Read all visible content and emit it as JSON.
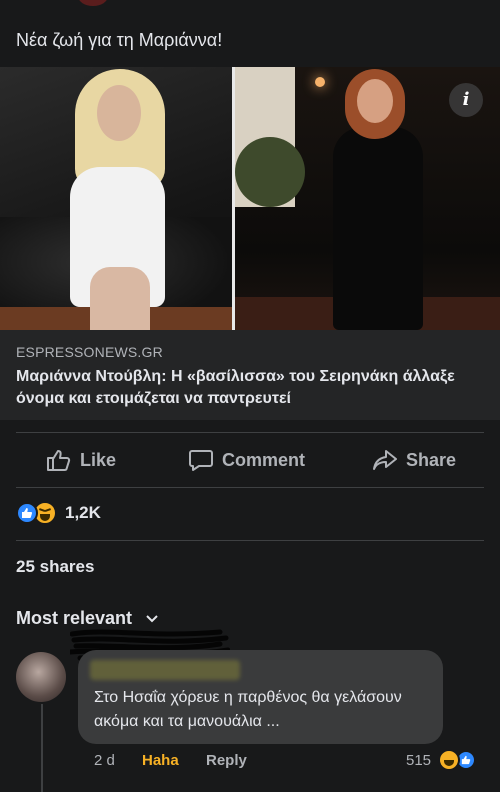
{
  "post": {
    "text": "Νέα ζωή για τη Μαριάννα!"
  },
  "link_preview": {
    "domain": "ESPRESSONEWS.GR",
    "title": "Μαριάννα Ντούβλη: Η «βασίλισσα» του Σειρηνάκη άλλαξε όνομα και ετοιμάζεται να παντρευτεί",
    "info_icon": "i"
  },
  "actions": {
    "like_label": "Like",
    "comment_label": "Comment",
    "share_label": "Share"
  },
  "reactions": {
    "count": "1,2K",
    "types": [
      "like-icon",
      "haha-icon"
    ]
  },
  "shares": {
    "label": "25 shares"
  },
  "comments_sort": {
    "label": "Most relevant"
  },
  "comment": {
    "text": "Στο Ησαΐα χόρευε η παρθένος θα γελάσουν ακόμα και τα μανουάλια ...",
    "time": "2 d",
    "reaction_label": "Haha",
    "reply_label": "Reply",
    "reaction_count": "515"
  },
  "colors": {
    "background": "#18191a",
    "card": "#242526",
    "bubble": "#3a3b3c",
    "like_blue": "#2d88ff",
    "haha_yellow": "#f7b125",
    "secondary_text": "#b0b3b8"
  }
}
